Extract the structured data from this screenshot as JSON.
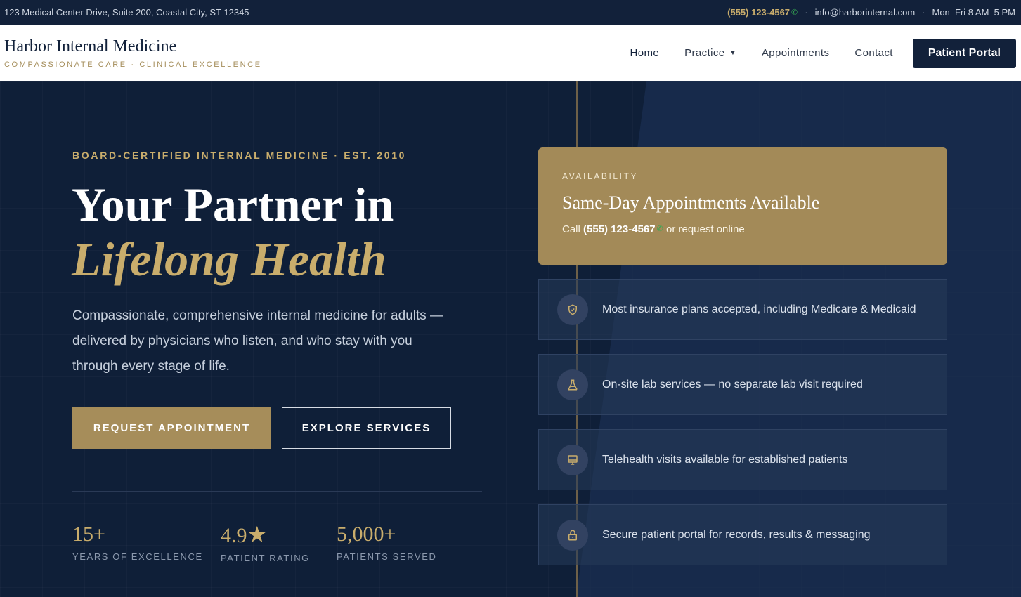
{
  "topbar": {
    "address": "123 Medical Center Drive, Suite 200, Coastal City, ST 12345",
    "phone": "(555) 123-4567",
    "separator": "·",
    "email": "info@harborinternal.com",
    "hours": "Mon–Fri 8 AM–5 PM"
  },
  "brand": {
    "name": "Harbor Internal Medicine",
    "tagline": "COMPASSIONATE CARE · CLINICAL EXCELLENCE"
  },
  "nav": {
    "home": "Home",
    "practice": "Practice",
    "practice_caret": "▼",
    "appointments": "Appointments",
    "contact": "Contact",
    "portal": "Patient Portal"
  },
  "hero": {
    "eyebrow": "BOARD-CERTIFIED INTERNAL MEDICINE · EST. 2010",
    "title_line1": "Your Partner in",
    "title_line2": "Lifelong Health",
    "lead": "Compassionate, comprehensive internal medicine for adults — delivered by physicians who listen, and who stay with you through every stage of life.",
    "primary_cta": "REQUEST APPOINTMENT",
    "secondary_cta": "EXPLORE SERVICES"
  },
  "stats": [
    {
      "value": "15+",
      "label": "YEARS OF EXCELLENCE"
    },
    {
      "value": "4.9",
      "suffix": "★",
      "label": "PATIENT RATING"
    },
    {
      "value": "5,000+",
      "label": "PATIENTS SERVED"
    }
  ],
  "availability": {
    "eyebrow": "AVAILABILITY",
    "title": "Same-Day Appointments Available",
    "call_prefix": "Call",
    "phone": "(555) 123-4567",
    "call_suffix": "or request online"
  },
  "features": [
    {
      "icon": "shield-check-icon",
      "text": "Most insurance plans accepted, including Medicare & Medicaid"
    },
    {
      "icon": "flask-icon",
      "text": "On-site lab services — no separate lab visit required"
    },
    {
      "icon": "monitor-icon",
      "text": "Telehealth visits available for established patients"
    },
    {
      "icon": "lock-icon",
      "text": "Secure patient portal for records, results & messaging"
    }
  ],
  "colors": {
    "navy": "#0f1f38",
    "gold": "#c9ad6c",
    "gold_card": "#a38a58",
    "phone_icon": "#35a853"
  }
}
